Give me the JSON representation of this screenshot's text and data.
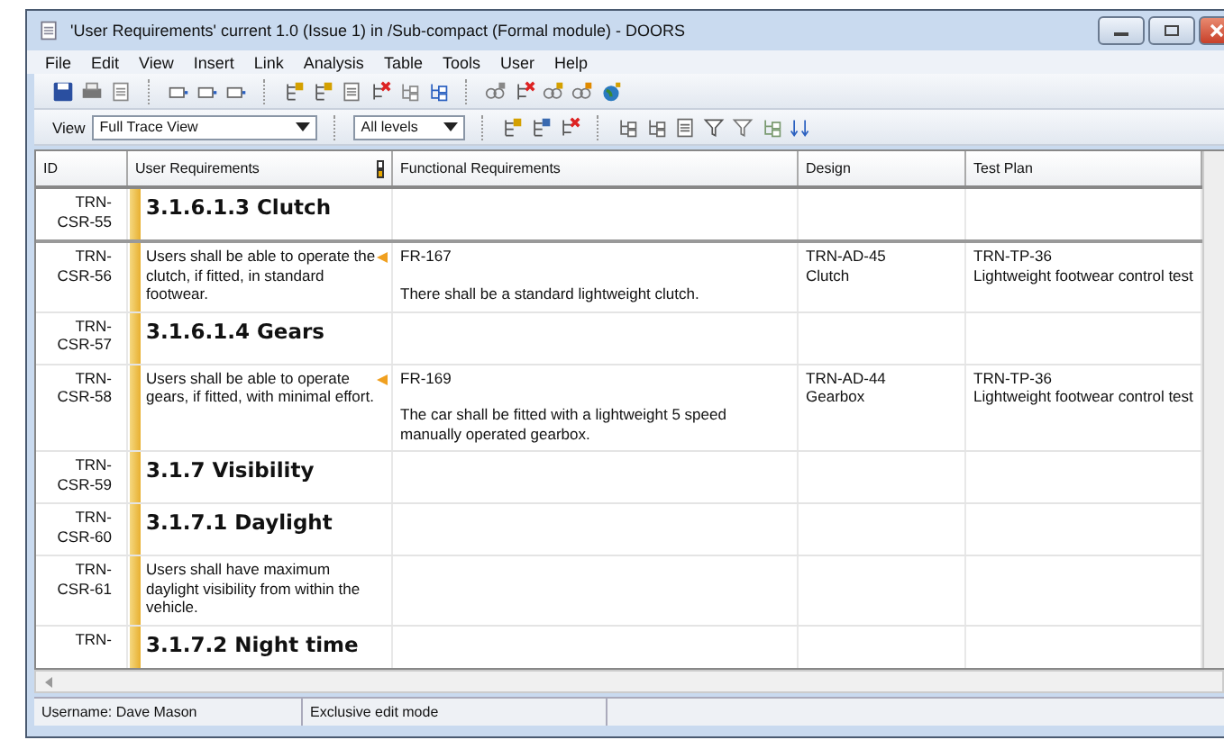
{
  "window": {
    "title": "'User Requirements' current 1.0 (Issue 1) in /Sub-compact (Formal module) - DOORS"
  },
  "menu": [
    "File",
    "Edit",
    "View",
    "Insert",
    "Link",
    "Analysis",
    "Table",
    "Tools",
    "User",
    "Help"
  ],
  "view_bar": {
    "label": "View",
    "view": "Full Trace View",
    "levels": "All levels"
  },
  "table": {
    "columns": [
      "ID",
      "User Requirements",
      "Functional Requirements",
      "Design",
      "Test Plan"
    ],
    "rows": [
      {
        "kind": "heading",
        "id": [
          "TRN-",
          "CSR-55"
        ],
        "text": "3.1.6.1.3 Clutch"
      },
      {
        "kind": "requirement",
        "id": [
          "TRN-",
          "CSR-56"
        ],
        "text": "Users shall be able to operate the clutch, if fitted, in standard footwear.",
        "linked": true,
        "functional": {
          "id": "FR-167",
          "text": "There shall be a standard lightweight clutch."
        },
        "design": {
          "id": "TRN-AD-45",
          "name": "Clutch"
        },
        "test": {
          "id": "TRN-TP-36",
          "name": "Lightweight footwear control test"
        }
      },
      {
        "kind": "heading",
        "id": [
          "TRN-",
          "CSR-57"
        ],
        "text": "3.1.6.1.4 Gears"
      },
      {
        "kind": "requirement",
        "id": [
          "TRN-",
          "CSR-58"
        ],
        "text": "Users shall be able to operate gears, if fitted, with minimal effort.",
        "linked": true,
        "functional": {
          "id": "FR-169",
          "text": "The car shall be fitted with a lightweight 5 speed manually operated gearbox."
        },
        "design": {
          "id": "TRN-AD-44",
          "name": "Gearbox"
        },
        "test": {
          "id": "TRN-TP-36",
          "name": "Lightweight footwear control test"
        }
      },
      {
        "kind": "heading",
        "id": [
          "TRN-",
          "CSR-59"
        ],
        "text": "3.1.7 Visibility"
      },
      {
        "kind": "heading",
        "id": [
          "TRN-",
          "CSR-60"
        ],
        "text": "3.1.7.1 Daylight"
      },
      {
        "kind": "requirement",
        "id": [
          "TRN-",
          "CSR-61"
        ],
        "text": "Users shall have maximum daylight visibility from within the vehicle.",
        "linked": false
      },
      {
        "kind": "heading",
        "id": [
          "TRN-"
        ],
        "text": "3.1.7.2 Night time"
      }
    ]
  },
  "status_bar": [
    "Username: Dave Mason",
    "Exclusive edit mode"
  ]
}
